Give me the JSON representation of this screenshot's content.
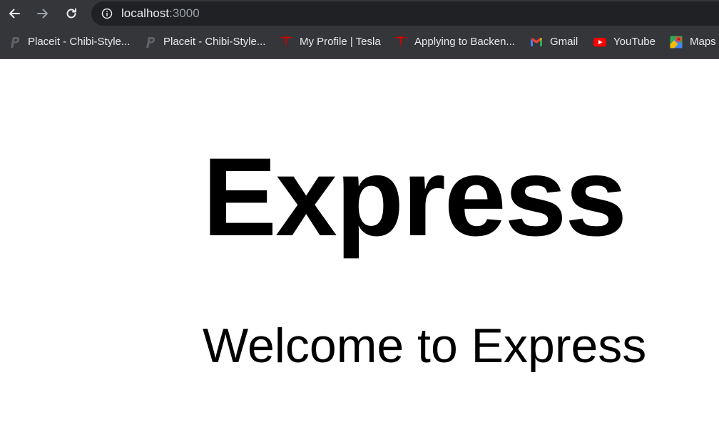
{
  "browser": {
    "address_bar": {
      "host": "localhost",
      "port": ":3000"
    },
    "bookmarks": [
      {
        "label": "Placeit - Chibi-Style...",
        "icon": "placeit-icon"
      },
      {
        "label": "Placeit - Chibi-Style...",
        "icon": "placeit-icon"
      },
      {
        "label": "My Profile | Tesla",
        "icon": "tesla-icon"
      },
      {
        "label": "Applying to Backen...",
        "icon": "tesla-icon"
      },
      {
        "label": "Gmail",
        "icon": "gmail-icon"
      },
      {
        "label": "YouTube",
        "icon": "youtube-icon"
      },
      {
        "label": "Maps",
        "icon": "maps-icon"
      }
    ],
    "colors": {
      "chrome_bg": "#35363a",
      "omnibox_bg": "#202124",
      "text": "#e8eaed",
      "muted": "#9aa0a6",
      "tesla_red": "#cc0000",
      "youtube_red": "#ff0000"
    }
  },
  "page": {
    "title": "Express",
    "text": "Welcome to Express"
  }
}
